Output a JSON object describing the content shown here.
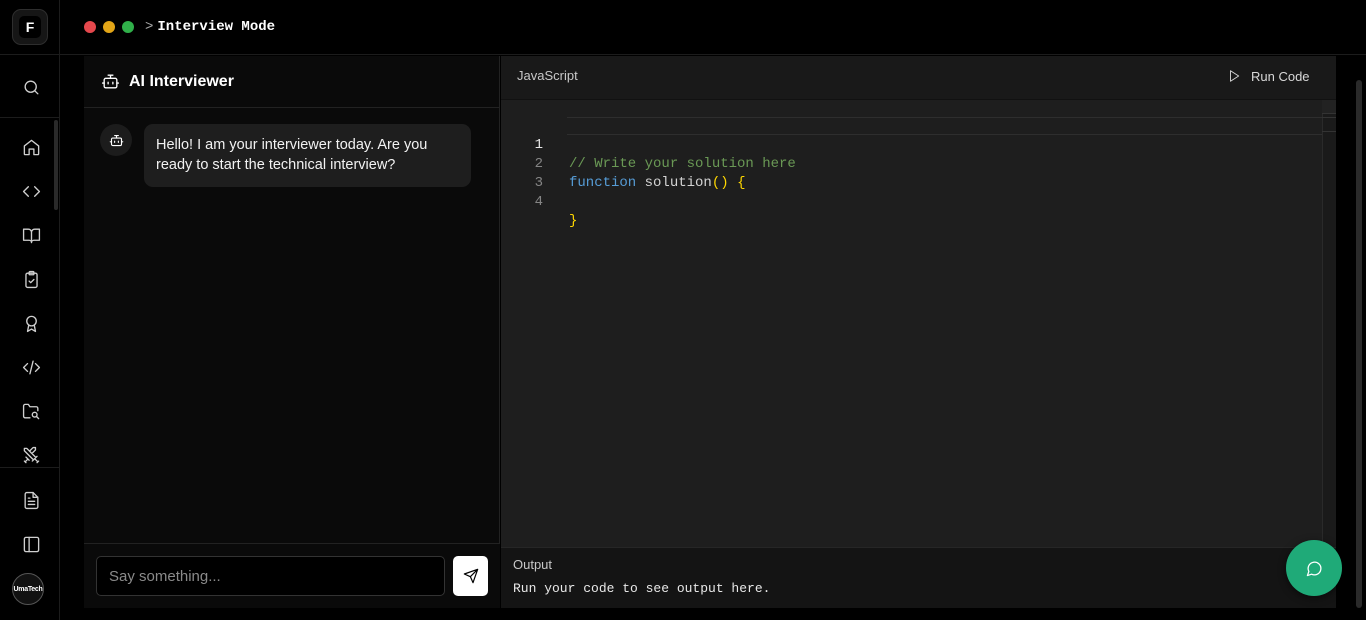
{
  "header": {
    "crumb_prefix": ">",
    "title": "Interview Mode",
    "window_dots": [
      "#e5484d",
      "#e2a517",
      "#30b04a"
    ]
  },
  "rail": {
    "logo": "F",
    "items": [
      {
        "name": "search",
        "icon": "search-icon"
      },
      {
        "name": "home",
        "icon": "home-icon"
      },
      {
        "name": "code",
        "icon": "code-icon"
      },
      {
        "name": "learn",
        "icon": "book-icon"
      },
      {
        "name": "tasks",
        "icon": "clipboard-check-icon"
      },
      {
        "name": "achievements",
        "icon": "award-icon"
      },
      {
        "name": "code-editor",
        "icon": "code-xml-icon"
      },
      {
        "name": "projects",
        "icon": "folder-search-icon"
      },
      {
        "name": "battle",
        "icon": "swords-icon"
      },
      {
        "name": "notes",
        "icon": "file-text-icon"
      },
      {
        "name": "toggle-sidebar",
        "icon": "panel-left-icon"
      }
    ],
    "avatar_text": "UmaTech"
  },
  "chat": {
    "title": "AI Interviewer",
    "messages": [
      {
        "role": "interviewer",
        "text": "Hello! I am your interviewer today. Are you ready to start the technical interview?"
      }
    ],
    "input_placeholder": "Say something..."
  },
  "editor": {
    "language": "JavaScript",
    "run_label": "Run Code",
    "lines": [
      {
        "number": "1"
      },
      {
        "number": "2"
      },
      {
        "number": "3"
      },
      {
        "number": "4"
      }
    ],
    "code": {
      "comment": "// Write your solution here",
      "keyword": "function",
      "fn_name": "solution",
      "parens": "()",
      "open_brace": "{",
      "close_brace": "}"
    },
    "output_label": "Output",
    "output_text": "Run your code to see output here."
  },
  "colors": {
    "accent": "#1faa78",
    "comment": "#6a9955",
    "keyword": "#569cd6",
    "bracket": "#ffd700"
  }
}
